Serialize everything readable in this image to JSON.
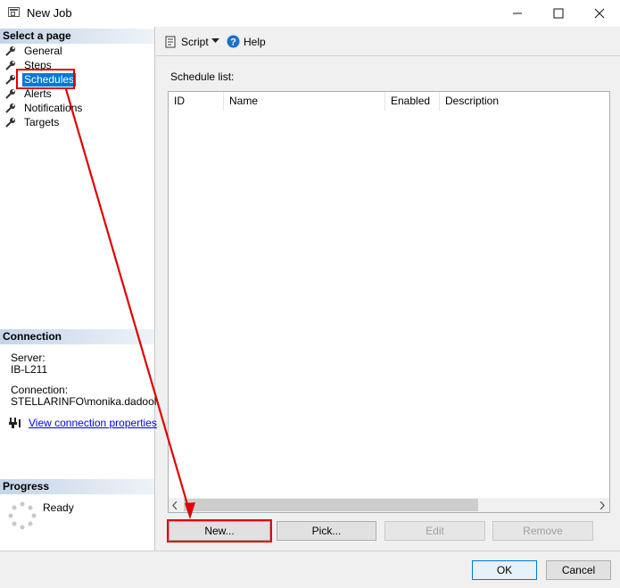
{
  "window": {
    "title": "New Job"
  },
  "left": {
    "select_page_header": "Select a page",
    "pages": [
      {
        "label": "General"
      },
      {
        "label": "Steps"
      },
      {
        "label": "Schedules"
      },
      {
        "label": "Alerts"
      },
      {
        "label": "Notifications"
      },
      {
        "label": "Targets"
      }
    ],
    "selected_page": "Schedules",
    "connection_header": "Connection",
    "server_label": "Server:",
    "server_value": "IB-L211",
    "connection_label": "Connection:",
    "connection_value": "STELLARINFO\\monika.dadool",
    "view_connection_link": "View connection properties",
    "progress_header": "Progress",
    "progress_status": "Ready"
  },
  "toolbar": {
    "script_label": "Script",
    "help_label": "Help"
  },
  "main": {
    "schedule_list_label": "Schedule list:",
    "columns": [
      "ID",
      "Name",
      "Enabled",
      "Description"
    ],
    "buttons": {
      "new": "New...",
      "pick": "Pick...",
      "edit": "Edit",
      "remove": "Remove"
    }
  },
  "footer": {
    "ok": "OK",
    "cancel": "Cancel"
  },
  "colors": {
    "selection": "#0078d7",
    "annotation_red": "#e00000",
    "link": "#0000ee"
  }
}
